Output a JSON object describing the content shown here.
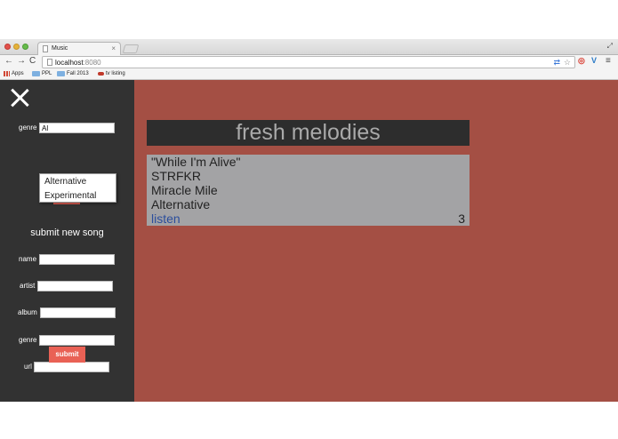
{
  "browser": {
    "tab_title": "Music",
    "tab_close": "×",
    "url_host": "localhost",
    "url_port": ":8080",
    "nav_back": "←",
    "nav_forward": "→",
    "nav_reload": "C",
    "ext_v": "V",
    "menu": "≡",
    "bookmarks": [
      "Apps",
      "PPL",
      "Fall 2013",
      "tv listing"
    ]
  },
  "sidebar": {
    "filter": {
      "label": "genre",
      "value": "Al"
    },
    "suggestions": [
      "Alternative",
      "Experimental"
    ],
    "form": {
      "title": "submit new song",
      "name_label": "name",
      "artist_label": "artist",
      "album_label": "album",
      "genre_label": "genre",
      "url_label": "url",
      "submit_label": "submit"
    }
  },
  "main": {
    "title": "fresh melodies",
    "song": {
      "name": "\"While I'm Alive\"",
      "artist": "STRFKR",
      "album": "Miracle Mile",
      "genre": "Alternative",
      "listen_label": "listen",
      "count": "3"
    }
  },
  "colors": {
    "sidebar_bg": "#323232",
    "main_bg": "#a44f44",
    "accent": "#e96155",
    "card_bg": "#a3a3a5",
    "link": "#2b4e9c"
  }
}
